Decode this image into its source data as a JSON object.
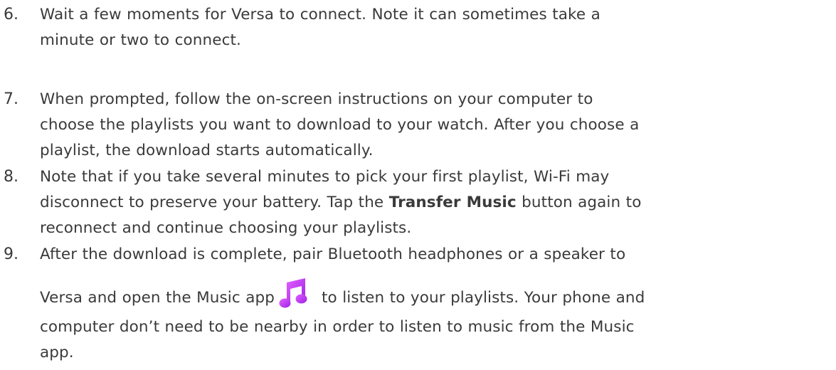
{
  "steps": [
    {
      "number": "6.",
      "lines": [
        "Wait a few moments for Versa to connect. Note it can sometimes take a",
        "minute or two to connect."
      ]
    },
    {
      "number": "7.",
      "lines": [
        "When prompted, follow the on-screen instructions on your computer to",
        "choose the playlists you want to download to your watch. After you choose a",
        "playlist, the download starts automatically."
      ]
    },
    {
      "number": "8.",
      "line1": "Note that if you take several minutes to pick your first playlist, Wi-Fi may",
      "line2_before": "disconnect to preserve your battery. Tap the ",
      "line2_bold": "Transfer Music",
      "line2_after": " button again to",
      "line3": "reconnect and continue choosing your playlists."
    },
    {
      "number": "9.",
      "line1": "After the download is complete, pair Bluetooth headphones or a speaker to",
      "line2_before": "Versa and open the Music app",
      "line2_after": "to listen to your playlists. Your phone and",
      "line3": "computer don’t need to be nearby in order to listen to music from the Music",
      "line4": "app.",
      "icon": "music-note-icon",
      "icon_color": "#c83cf0"
    }
  ]
}
